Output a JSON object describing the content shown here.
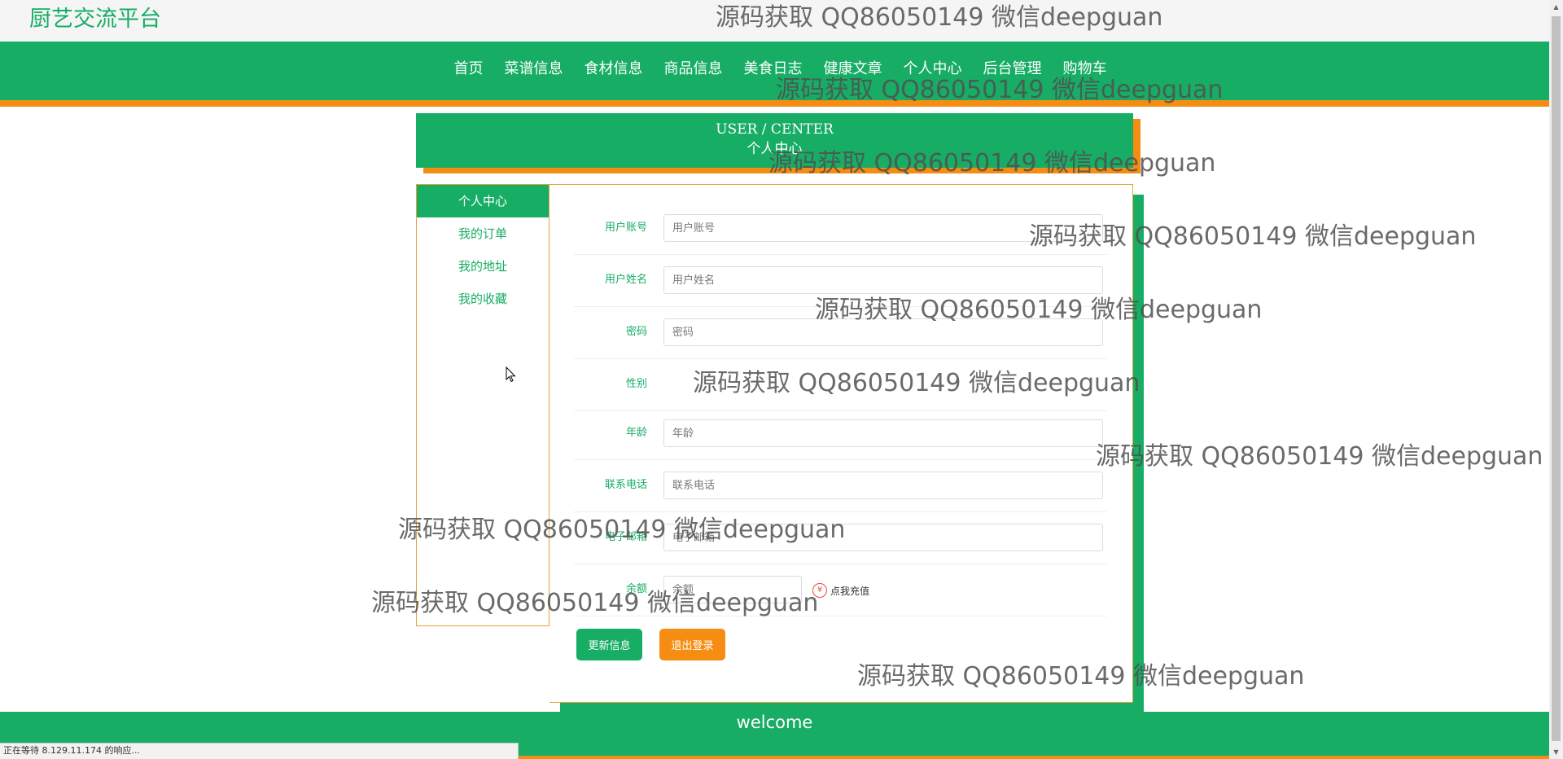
{
  "site": {
    "title": "厨艺交流平台"
  },
  "nav": {
    "items": [
      {
        "label": "首页"
      },
      {
        "label": "菜谱信息"
      },
      {
        "label": "食材信息"
      },
      {
        "label": "商品信息"
      },
      {
        "label": "美食日志"
      },
      {
        "label": "健康文章"
      },
      {
        "label": "个人中心"
      },
      {
        "label": "后台管理"
      },
      {
        "label": "购物车"
      }
    ]
  },
  "header": {
    "en": "USER / CENTER",
    "cn": "个人中心"
  },
  "sidebar": {
    "items": [
      {
        "label": "个人中心",
        "active": true
      },
      {
        "label": "我的订单",
        "active": false
      },
      {
        "label": "我的地址",
        "active": false
      },
      {
        "label": "我的收藏",
        "active": false
      }
    ]
  },
  "form": {
    "fields": [
      {
        "label": "用户账号",
        "placeholder": "用户账号",
        "value": ""
      },
      {
        "label": "用户姓名",
        "placeholder": "用户姓名",
        "value": ""
      },
      {
        "label": "密码",
        "placeholder": "密码",
        "value": ""
      },
      {
        "label": "性别",
        "placeholder": "",
        "value": ""
      },
      {
        "label": "年龄",
        "placeholder": "年龄",
        "value": ""
      },
      {
        "label": "联系电话",
        "placeholder": "联系电话",
        "value": ""
      },
      {
        "label": "电子邮箱",
        "placeholder": "电子邮箱",
        "value": ""
      },
      {
        "label": "余额",
        "placeholder": "余额",
        "value": ""
      }
    ],
    "recharge_label": "点我充值",
    "recharge_symbol": "¥",
    "update_button": "更新信息",
    "logout_button": "退出登录"
  },
  "footer": {
    "text": "welcome"
  },
  "status": {
    "text": "正在等待 8.129.11.174 的响应..."
  },
  "watermark": {
    "text": "源码获取 QQ86050149 微信deepguan"
  },
  "colors": {
    "primary": "#17ad65",
    "accent": "#f58d13",
    "border": "#e6a23c"
  }
}
